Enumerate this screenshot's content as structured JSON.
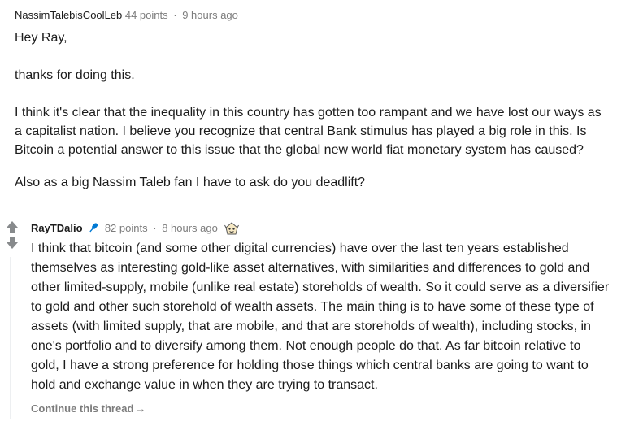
{
  "parent_comment": {
    "author": "NassimTalebisCoolLeb",
    "points": "44 points",
    "separator": "·",
    "time": "9 hours ago",
    "paragraphs": [
      "Hey Ray,",
      "thanks for doing this.",
      "I think it's clear that the inequality in this country has gotten too rampant and we have lost our ways as a capitalist nation. I believe you recognize that central Bank stimulus has played a big role in this. Is Bitcoin a potential answer to this issue that the global new world fiat monetary system has caused?",
      "Also as a big Nassim Taleb fan I have to ask do you deadlift?"
    ]
  },
  "reply_comment": {
    "author": "RayTDalio",
    "author_badge_icon": "microphone-icon",
    "points": "82 points",
    "separator": "·",
    "time": "8 hours ago",
    "award_icon": "wholesome-award-icon",
    "body": "I think that bitcoin (and some other digital currencies) have over the last ten years established themselves as interesting gold-like asset alternatives, with similarities and differences to gold and other limited-supply, mobile (unlike real estate) storeholds of wealth. So it could serve as a diversifier to gold and other such storehold of wealth assets. The main thing is to have some of these type of assets (with limited supply, that are mobile, and that are storeholds of wealth), including stocks, in one's portfolio and to diversify among them. Not enough people do that. As far bitcoin relative to gold, I have a strong preference for holding those things which central banks are going to want to hold and exchange value in when they are trying to transact.",
    "continue_label": "Continue this thread",
    "continue_arrow": "→"
  },
  "colors": {
    "text": "#1c1c1c",
    "meta": "#7c7c7c",
    "vote_arrow": "#878a8c",
    "thread_line": "#edeff1",
    "mic_blue": "#0079d3"
  }
}
